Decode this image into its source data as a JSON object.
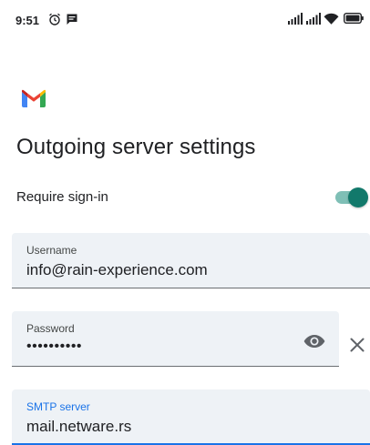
{
  "status_bar": {
    "time": "9:51",
    "left_icons": [
      "alarm-icon",
      "message-icon"
    ],
    "right_icons": [
      "signal-icon",
      "signal-icon",
      "wifi-icon",
      "battery-icon"
    ]
  },
  "app": {
    "logo": "gmail-logo"
  },
  "page": {
    "title": "Outgoing server settings"
  },
  "require_signin": {
    "label": "Require sign-in",
    "enabled": true
  },
  "fields": {
    "username": {
      "label": "Username",
      "value": "info@rain-experience.com"
    },
    "password": {
      "label": "Password",
      "value": "••••••••••",
      "action_icon": "eye-icon"
    },
    "smtp_server": {
      "label": "SMTP server",
      "value": "mail.netware.rs"
    }
  },
  "colors": {
    "accent": "#1a73e8",
    "toggle_on": "#12796b",
    "field_bg": "#eef2f6"
  }
}
